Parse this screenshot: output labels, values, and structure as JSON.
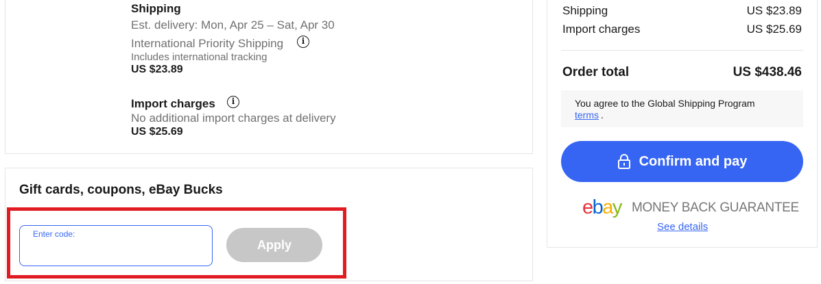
{
  "shipping_section": {
    "title": "Shipping",
    "est_delivery": "Est. delivery: Mon, Apr 25 – Sat, Apr 30",
    "method": "International Priority Shipping",
    "method_note": "Includes international tracking",
    "price": "US $23.89",
    "info_icon": "info-icon"
  },
  "import_section": {
    "title": "Import charges",
    "note": "No additional import charges at delivery",
    "price": "US $25.69",
    "info_icon": "info-icon"
  },
  "gift_section": {
    "title": "Gift cards, coupons, eBay Bucks",
    "input_label": "Enter code:",
    "input_value": "",
    "apply_label": "Apply"
  },
  "summary": {
    "rows": [
      {
        "label": "Shipping",
        "value": "US $23.89"
      },
      {
        "label": "Import charges",
        "value": "US $25.69"
      }
    ],
    "total_label": "Order total",
    "total_value": "US $438.46",
    "agree_text": "You agree to the Global Shipping Program",
    "terms_link": "terms",
    "terms_suffix": ".",
    "confirm_label": "Confirm and pay",
    "confirm_icon": "lock-icon",
    "logo_letters": [
      "e",
      "b",
      "a",
      "y"
    ],
    "logo_colors": [
      "#e53238",
      "#0064d2",
      "#f5af02",
      "#86b817"
    ],
    "guarantee_text": "MONEY BACK GUARANTEE",
    "see_details": "See details"
  },
  "colors": {
    "accent_blue": "#3665f3",
    "highlight_red": "#e11b22",
    "disabled_grey": "#c7c7c7"
  }
}
